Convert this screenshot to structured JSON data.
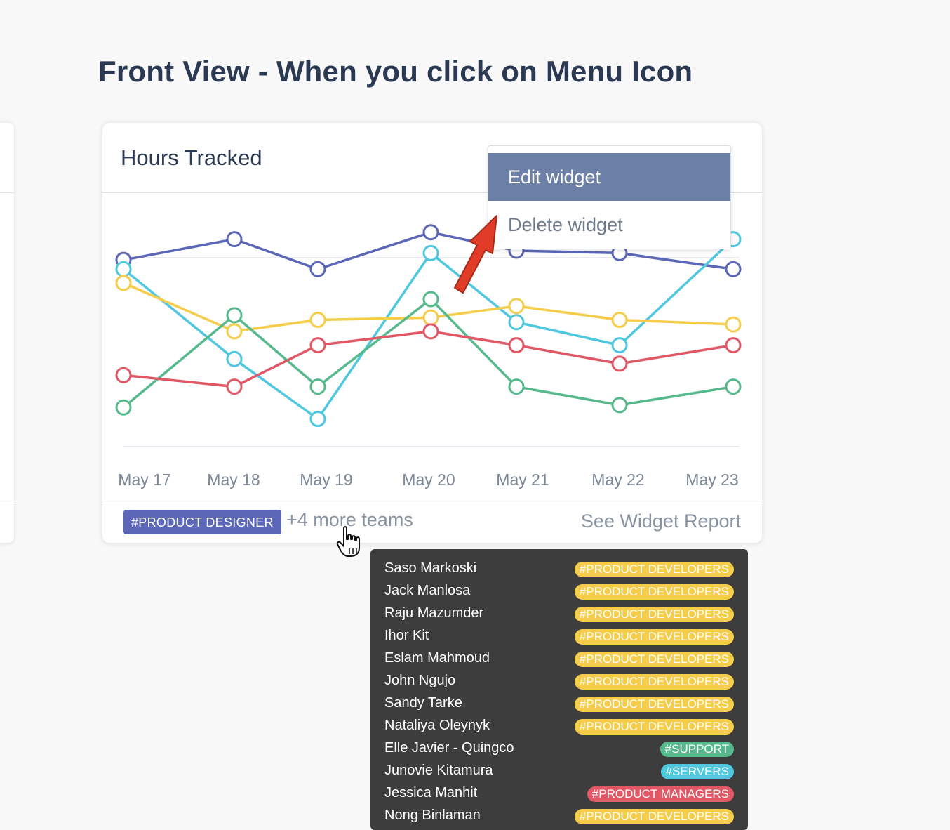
{
  "heading": "Front View - When you click on Menu Icon",
  "widget": {
    "title": "Hours Tracked",
    "footer": {
      "team_tag": "#PRODUCT DESIGNER",
      "more_teams": "+4 more teams",
      "report_link": "See Widget Report"
    }
  },
  "menu": {
    "items": [
      {
        "label": "Edit widget"
      },
      {
        "label": "Delete widget"
      }
    ]
  },
  "chart_data": {
    "type": "line",
    "categories": [
      "May 17",
      "May 18",
      "May 19",
      "May 20",
      "May 21",
      "May 22",
      "May 23"
    ],
    "ylim": [
      0,
      11
    ],
    "grid": true,
    "series": [
      {
        "color": "#5c67b8",
        "values": [
          8.1,
          9.0,
          7.7,
          9.3,
          8.5,
          8.4,
          7.7
        ]
      },
      {
        "color": "#4fc7df",
        "values": [
          7.7,
          3.8,
          1.2,
          8.4,
          5.4,
          4.4,
          9.0
        ]
      },
      {
        "color": "#f6cd4b",
        "values": [
          7.1,
          5.0,
          5.5,
          5.6,
          6.1,
          5.5,
          5.3
        ]
      },
      {
        "color": "#56b98c",
        "values": [
          1.7,
          5.7,
          2.6,
          6.4,
          2.6,
          1.8,
          2.6
        ]
      },
      {
        "color": "#e05765",
        "values": [
          3.1,
          2.6,
          4.4,
          5.0,
          4.4,
          3.6,
          4.4
        ]
      }
    ]
  },
  "team_popup": {
    "members": [
      {
        "name": "Saso Markoski",
        "team": "#PRODUCT DEVELOPERS",
        "kind": "dev"
      },
      {
        "name": "Jack Manlosa",
        "team": "#PRODUCT DEVELOPERS",
        "kind": "dev"
      },
      {
        "name": "Raju Mazumder",
        "team": "#PRODUCT DEVELOPERS",
        "kind": "dev"
      },
      {
        "name": "Ihor Kit",
        "team": "#PRODUCT DEVELOPERS",
        "kind": "dev"
      },
      {
        "name": "Eslam Mahmoud",
        "team": "#PRODUCT DEVELOPERS",
        "kind": "dev"
      },
      {
        "name": "John Ngujo",
        "team": "#PRODUCT DEVELOPERS",
        "kind": "dev"
      },
      {
        "name": "Sandy Tarke",
        "team": "#PRODUCT DEVELOPERS",
        "kind": "dev"
      },
      {
        "name": "Nataliya Oleynyk",
        "team": "#PRODUCT DEVELOPERS",
        "kind": "dev"
      },
      {
        "name": "Elle Javier - Quingco",
        "team": "#SUPPORT",
        "kind": "support"
      },
      {
        "name": "Junovie Kitamura",
        "team": "#SERVERS",
        "kind": "servers"
      },
      {
        "name": "Jessica Manhit",
        "team": "#PRODUCT MANAGERS",
        "kind": "managers"
      },
      {
        "name": "Nong Binlaman",
        "team": "#PRODUCT DEVELOPERS",
        "kind": "dev"
      }
    ]
  }
}
